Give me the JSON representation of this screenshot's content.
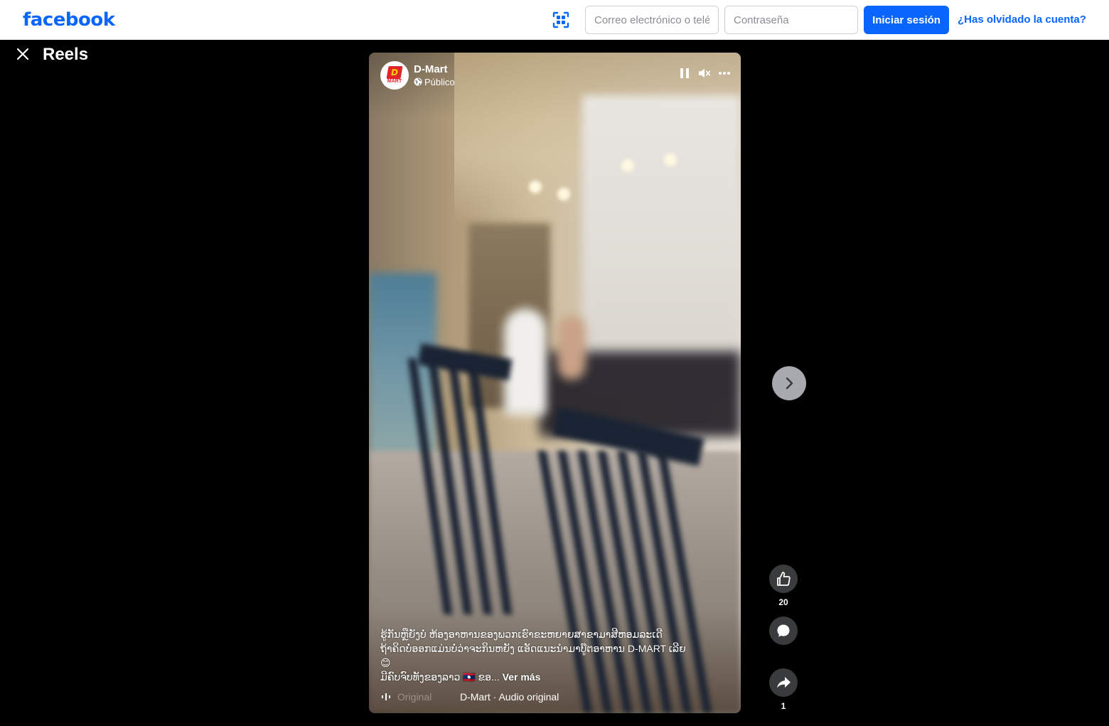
{
  "header": {
    "logo": "facebook",
    "email_placeholder": "Correo electrónico o teléfono",
    "password_placeholder": "Contraseña",
    "login_label": "Iniciar sesión",
    "forgot_label": "¿Has olvidado la cuenta?"
  },
  "reels": {
    "title": "Reels"
  },
  "post": {
    "page_name": "D-Mart",
    "avatar_letter": "D",
    "avatar_text": "MART",
    "privacy": "Público",
    "caption_lines": [
      "ຮູ້ກັນຫຼືຍັງບໍ່ ຫ້ອງອາຫານຂອງພວກເຮົາຂະຫຍາຍສາຂາມາສີຫອມລະເດີ",
      "ຖ້າຄິດບໍ່ອອກແມ່ນບໍ່ວ່າຈະກິນຫຍັງ ແອັດແນະນຳມາບູ໊ຕອາຫານ D-MART ເລີຍ",
      "😊",
      "ມີຄົບຈົບທັງຂອງລາວ 🇱🇦 ຂອ..."
    ],
    "see_more": "Ver más",
    "audio_faded": "Original",
    "audio_text": "D-Mart · Audio original",
    "likes": "20",
    "shares": "1"
  },
  "icons": {
    "qr": "qr-scan-icon",
    "close": "close-icon",
    "pause": "pause-icon",
    "mute": "speaker-muted-icon",
    "more": "more-dots-icon",
    "next": "chevron-right-icon",
    "like": "thumbs-up-icon",
    "comment": "comment-icon",
    "share": "share-icon",
    "globe": "globe-icon",
    "audio": "audio-wave-icon"
  },
  "colors": {
    "brand": "#0866ff",
    "background": "#000000",
    "action_button": "#3a3b3c"
  }
}
